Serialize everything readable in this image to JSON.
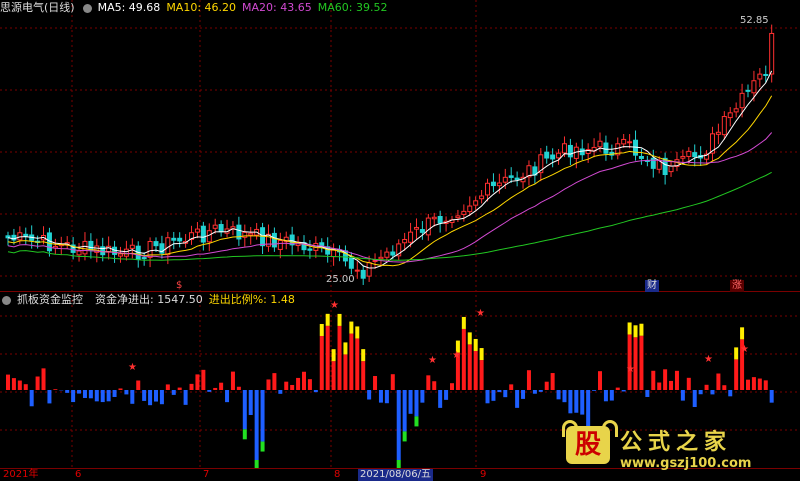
{
  "main": {
    "title": "思源电气(日线)",
    "ma": [
      {
        "label": "MA5: 49.68",
        "color": "#ffffff"
      },
      {
        "label": "MA10: 46.20",
        "color": "#ffd700"
      },
      {
        "label": "MA20: 43.65",
        "color": "#d24ad2"
      },
      {
        "label": "MA60: 39.52",
        "color": "#22c622"
      }
    ],
    "high_label": "52.85",
    "low_label": "25.00",
    "markers": [
      {
        "text": "$",
        "color": "#ff4444"
      },
      {
        "text": "财",
        "color": "#dddddd"
      },
      {
        "text": "涨",
        "color": "#ff6666"
      }
    ]
  },
  "sub": {
    "title": "抓板资金监控",
    "net_label": "资金净进出: 1547.50",
    "ratio_label": "进出比例%: 1.48",
    "net_color": "#dddddd",
    "ratio_color": "#ffd700"
  },
  "axis": {
    "labels": [
      "2021年",
      "6",
      "7",
      "8",
      "2021/08/06/五",
      "9"
    ]
  },
  "logo": {
    "icon": "股",
    "name": "公式之家",
    "url": "www.gszj100.com"
  },
  "colors": {
    "up": "#ff3030",
    "down": "#22d3d3",
    "ma5": "#ffffff",
    "ma10": "#ffd700",
    "ma20": "#d24ad2",
    "ma60": "#22c622",
    "bar_red": "#ff1a1a",
    "bar_yellow": "#ffee00",
    "bar_blue": "#1e5fff",
    "bar_green": "#22e022",
    "grid": "#7a0000"
  }
}
